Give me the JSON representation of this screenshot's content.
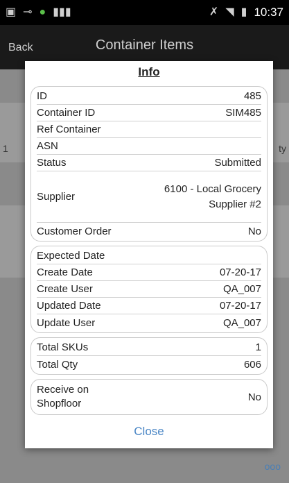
{
  "status_bar": {
    "time": "10:37",
    "icons": [
      "image-icon",
      "key-icon",
      "android-notify-icon",
      "barcode-icon",
      "mute-icon",
      "wifi-icon",
      "battery-icon"
    ]
  },
  "app_bar": {
    "back_label": "Back",
    "title": "Container Items"
  },
  "background": {
    "row_number": "1",
    "qty_label_fragment": "ty",
    "footer_link": "ooo"
  },
  "modal": {
    "title": "Info",
    "group1": [
      {
        "label": "ID",
        "value": "485"
      },
      {
        "label": "Container ID",
        "value": "SIM485"
      },
      {
        "label": "Ref Container",
        "value": ""
      },
      {
        "label": "ASN",
        "value": ""
      },
      {
        "label": "Status",
        "value": "Submitted"
      },
      {
        "label": "Supplier",
        "value": "6100 - Local Grocery Supplier #2"
      },
      {
        "label": "Customer Order",
        "value": "No"
      }
    ],
    "group2": [
      {
        "label": "Expected Date",
        "value": ""
      },
      {
        "label": "Create Date",
        "value": "07-20-17"
      },
      {
        "label": "Create User",
        "value": "QA_007"
      },
      {
        "label": "Updated Date",
        "value": "07-20-17"
      },
      {
        "label": "Update User",
        "value": "QA_007"
      }
    ],
    "group3": [
      {
        "label": "Total SKUs",
        "value": "1"
      },
      {
        "label": "Total Qty",
        "value": "606"
      }
    ],
    "group4": [
      {
        "label": "Receive on Shopfloor",
        "value": "No"
      }
    ],
    "close_label": "Close"
  }
}
